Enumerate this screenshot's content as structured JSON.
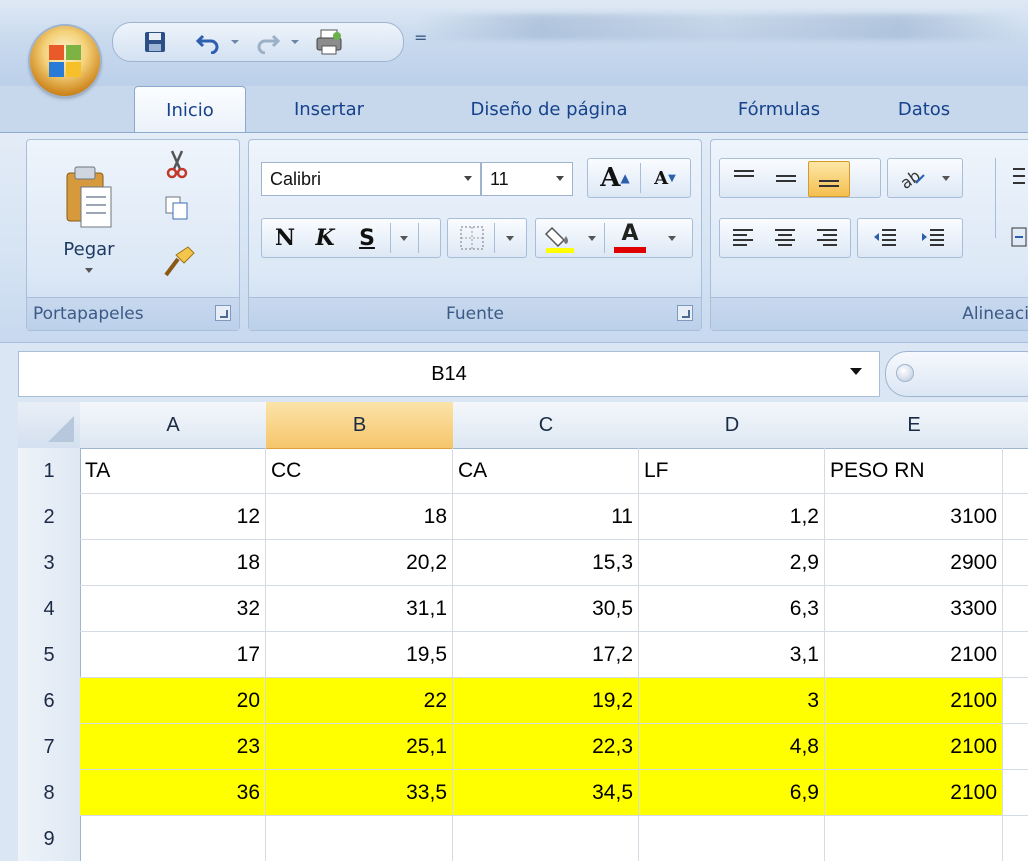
{
  "quick_access": {
    "icons": [
      "save-icon",
      "undo-icon",
      "redo-icon",
      "print-preview-icon",
      "customize-icon"
    ],
    "more_glyph": "="
  },
  "tabs": [
    {
      "label": "Inicio",
      "active": true
    },
    {
      "label": "Insertar",
      "active": false
    },
    {
      "label": "Diseño de página",
      "active": false
    },
    {
      "label": "Fórmulas",
      "active": false
    },
    {
      "label": "Datos",
      "active": false
    }
  ],
  "ribbon": {
    "clipboard": {
      "paste_label": "Pegar",
      "group_label": "Portapapeles"
    },
    "font": {
      "font_name": "Calibri",
      "font_size": "11",
      "group_label": "Fuente",
      "bold": "N",
      "italic": "K",
      "underline": "S",
      "font_color": "A",
      "grow_font": "A",
      "shrink_font": "A",
      "fill_color": "#ffff00",
      "text_color": "#e00000"
    },
    "alignment": {
      "group_label": "Alineaci"
    }
  },
  "formula_bar": {
    "name_box": "B14"
  },
  "sheet": {
    "columns": [
      {
        "label": "A",
        "selected": false
      },
      {
        "label": "B",
        "selected": true
      },
      {
        "label": "C",
        "selected": false
      },
      {
        "label": "D",
        "selected": false
      },
      {
        "label": "E",
        "selected": false
      }
    ],
    "row_numbers": [
      "1",
      "2",
      "3",
      "4",
      "5",
      "6",
      "7",
      "8",
      "9"
    ],
    "rows": [
      {
        "cells": [
          "TA",
          "CC",
          "CA",
          "LF",
          "PESO RN"
        ],
        "type": "text",
        "highlight": false
      },
      {
        "cells": [
          "12",
          "18",
          "11",
          "1,2",
          "3100"
        ],
        "type": "num",
        "highlight": false
      },
      {
        "cells": [
          "18",
          "20,2",
          "15,3",
          "2,9",
          "2900"
        ],
        "type": "num",
        "highlight": false
      },
      {
        "cells": [
          "32",
          "31,1",
          "30,5",
          "6,3",
          "3300"
        ],
        "type": "num",
        "highlight": false
      },
      {
        "cells": [
          "17",
          "19,5",
          "17,2",
          "3,1",
          "2100"
        ],
        "type": "num",
        "highlight": false
      },
      {
        "cells": [
          "20",
          "22",
          "19,2",
          "3",
          "2100"
        ],
        "type": "num",
        "highlight": true
      },
      {
        "cells": [
          "23",
          "25,1",
          "22,3",
          "4,8",
          "2100"
        ],
        "type": "num",
        "highlight": true
      },
      {
        "cells": [
          "36",
          "33,5",
          "34,5",
          "6,9",
          "2100"
        ],
        "type": "num",
        "highlight": true
      },
      {
        "cells": [
          "",
          "",
          "",
          "",
          ""
        ],
        "type": "text",
        "highlight": false
      }
    ],
    "highlight_color": "#ffff00"
  }
}
